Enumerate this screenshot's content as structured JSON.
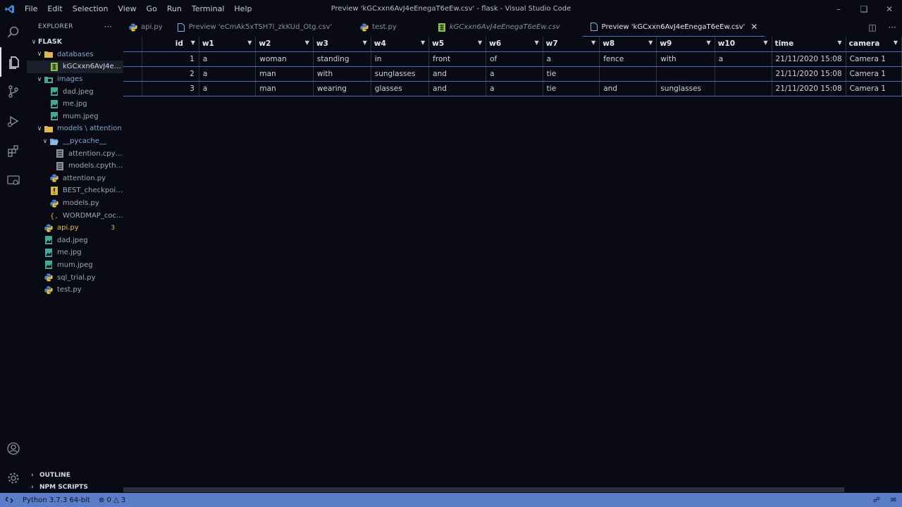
{
  "menu": [
    "File",
    "Edit",
    "Selection",
    "View",
    "Go",
    "Run",
    "Terminal",
    "Help"
  ],
  "window_title": "Preview 'kGCxxn6AvJ4eEnegaT6eEw.csv' - flask - Visual Studio Code",
  "sidebar": {
    "title": "EXPLORER",
    "root": "FLASK",
    "items": [
      {
        "label": "databases",
        "type": "folder",
        "depth": 1,
        "open": true
      },
      {
        "label": "kGCxxn6AvJ4eE...",
        "type": "csv",
        "depth": 2,
        "selected": true
      },
      {
        "label": "images",
        "type": "folder-img",
        "depth": 1,
        "open": true
      },
      {
        "label": "dad.jpeg",
        "type": "image",
        "depth": 2
      },
      {
        "label": "me.jpg",
        "type": "image",
        "depth": 2
      },
      {
        "label": "mum.jpeg",
        "type": "image",
        "depth": 2
      },
      {
        "label": "models \\ attention",
        "type": "folder",
        "depth": 1,
        "open": true
      },
      {
        "label": "__pycache__",
        "type": "folder-open",
        "depth": 2,
        "open": true
      },
      {
        "label": "attention.cpyth...",
        "type": "binary",
        "depth": 3
      },
      {
        "label": "models.cpytho...",
        "type": "binary",
        "depth": 3
      },
      {
        "label": "attention.py",
        "type": "python",
        "depth": 2
      },
      {
        "label": "BEST_checkpoin...",
        "type": "checkpoint",
        "depth": 2
      },
      {
        "label": "models.py",
        "type": "python",
        "depth": 2
      },
      {
        "label": "WORDMAP_coc...",
        "type": "json",
        "depth": 2
      },
      {
        "label": "api.py",
        "type": "python",
        "depth": 1,
        "badge": "3",
        "modified": true
      },
      {
        "label": "dad.jpeg",
        "type": "image",
        "depth": 1
      },
      {
        "label": "me.jpg",
        "type": "image",
        "depth": 1
      },
      {
        "label": "mum.jpeg",
        "type": "image",
        "depth": 1
      },
      {
        "label": "sql_trial.py",
        "type": "python",
        "depth": 1
      },
      {
        "label": "test.py",
        "type": "python",
        "depth": 1
      }
    ],
    "outline": "OUTLINE",
    "npm": "NPM SCRIPTS"
  },
  "tabs": [
    {
      "label": "api.py",
      "icon": "python"
    },
    {
      "label": "Preview 'eCmAk5xTSH7l_zkKUd_Otg.csv'",
      "icon": "preview"
    },
    {
      "label": "test.py",
      "icon": "python"
    },
    {
      "label": "kGCxxn6AvJ4eEnegaT6eEw.csv",
      "icon": "csv",
      "italic": true
    },
    {
      "label": "Preview 'kGCxxn6AvJ4eEnegaT6eEw.csv'",
      "icon": "preview",
      "active": true
    }
  ],
  "grid": {
    "columns": [
      "id",
      "w1",
      "w2",
      "w3",
      "w4",
      "w5",
      "w6",
      "w7",
      "w8",
      "w9",
      "w10",
      "time",
      "camera"
    ],
    "rows": [
      [
        "1",
        "a",
        "woman",
        "standing",
        "in",
        "front",
        "of",
        "a",
        "fence",
        "with",
        "a",
        "21/11/2020 15:08",
        "Camera 1"
      ],
      [
        "2",
        "a",
        "man",
        "with",
        "sunglasses",
        "and",
        "a",
        "tie",
        "",
        "",
        "",
        "21/11/2020 15:08",
        "Camera 1"
      ],
      [
        "3",
        "a",
        "man",
        "wearing",
        "glasses",
        "and",
        "a",
        "tie",
        "and",
        "sunglasses",
        "",
        "21/11/2020 15:08",
        "Camera 1"
      ]
    ]
  },
  "status": {
    "python": "Python 3.7.3 64-bit",
    "errors": "0",
    "warnings": "3"
  },
  "colors": {
    "statusbar": "#5b7dc7",
    "background": "#0a0a14",
    "python_yellow": "#e0c04a",
    "csv_green": "#8bc34a"
  }
}
